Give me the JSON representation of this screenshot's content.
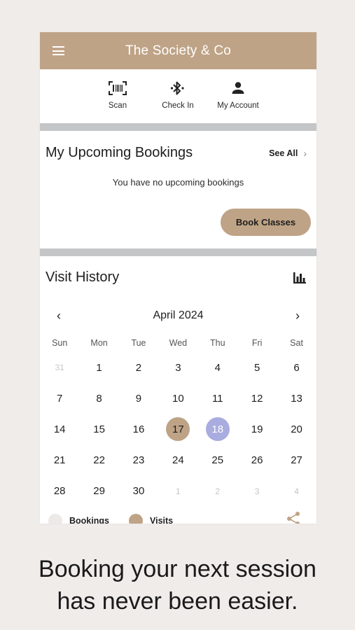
{
  "app": {
    "title": "The Society & Co",
    "accent_color": "#bfa386",
    "today_color": "#a9acde"
  },
  "quick_actions": [
    {
      "label": "Scan",
      "icon": "barcode-scan-icon"
    },
    {
      "label": "Check In",
      "icon": "bluetooth-icon"
    },
    {
      "label": "My Account",
      "icon": "person-icon"
    }
  ],
  "bookings": {
    "title": "My Upcoming Bookings",
    "see_all": "See All",
    "empty_message": "You have no upcoming bookings",
    "book_button": "Book Classes"
  },
  "visit_history": {
    "title": "Visit History",
    "month": "April 2024",
    "weekdays": [
      "Sun",
      "Mon",
      "Tue",
      "Wed",
      "Thu",
      "Fri",
      "Sat"
    ],
    "weeks": [
      [
        {
          "d": "31",
          "m": true
        },
        {
          "d": "1"
        },
        {
          "d": "2"
        },
        {
          "d": "3"
        },
        {
          "d": "4"
        },
        {
          "d": "5"
        },
        {
          "d": "6"
        }
      ],
      [
        {
          "d": "7"
        },
        {
          "d": "8"
        },
        {
          "d": "9"
        },
        {
          "d": "10"
        },
        {
          "d": "11"
        },
        {
          "d": "12"
        },
        {
          "d": "13"
        }
      ],
      [
        {
          "d": "14"
        },
        {
          "d": "15"
        },
        {
          "d": "16"
        },
        {
          "d": "17",
          "s": "visit"
        },
        {
          "d": "18",
          "s": "today"
        },
        {
          "d": "19"
        },
        {
          "d": "20"
        }
      ],
      [
        {
          "d": "21"
        },
        {
          "d": "22"
        },
        {
          "d": "23"
        },
        {
          "d": "24"
        },
        {
          "d": "25"
        },
        {
          "d": "26"
        },
        {
          "d": "27"
        }
      ],
      [
        {
          "d": "28"
        },
        {
          "d": "29"
        },
        {
          "d": "30"
        },
        {
          "d": "1",
          "m": true
        },
        {
          "d": "2",
          "m": true
        },
        {
          "d": "3",
          "m": true
        },
        {
          "d": "4",
          "m": true
        }
      ]
    ],
    "legend": [
      {
        "label": "Bookings",
        "color": "#ece9e6"
      },
      {
        "label": "Visits",
        "color": "#bfa386"
      }
    ]
  },
  "tagline": [
    "Booking your next session",
    "has never been easier."
  ]
}
